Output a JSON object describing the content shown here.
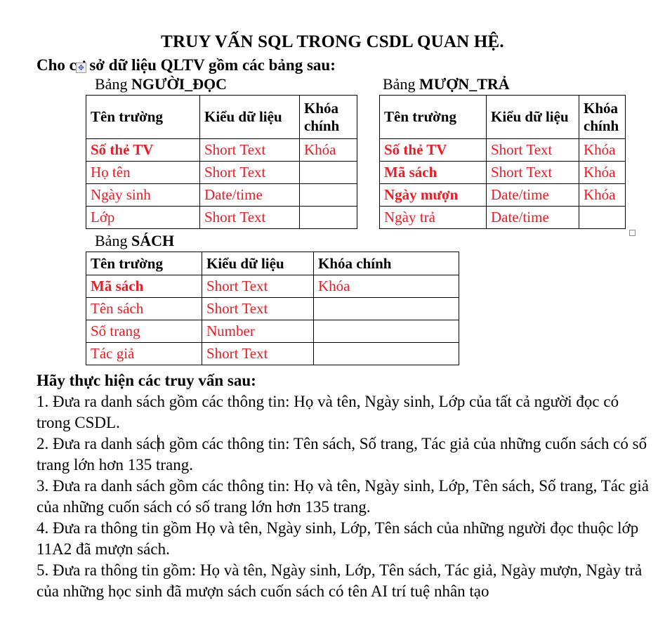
{
  "document": {
    "title": "TRUY VẤN SQL TRONG CSDL QUAN HỆ.",
    "intro": "Cho cơ sở dữ liệu QLTV gồm các bảng sau:",
    "move_handle_glyph": "✥",
    "text_color": "#000000",
    "value_color": "#ee1b24"
  },
  "tables": {
    "nguoi_doc": {
      "caption_prefix": "Bảng ",
      "caption_name": "NGƯỜI_ĐỌC",
      "headers": [
        "Tên trường",
        "Kiểu dữ liệu",
        "Khóa chính"
      ],
      "rows": [
        {
          "field": "Số thẻ TV",
          "type": "Short Text",
          "key": "Khóa",
          "bold": true
        },
        {
          "field": "Họ tên",
          "type": "Short Text",
          "key": "",
          "bold": false
        },
        {
          "field": "Ngày sinh",
          "type": "Date/time",
          "key": "",
          "bold": false
        },
        {
          "field": "Lớp",
          "type": "Short Text",
          "key": "",
          "bold": false
        }
      ]
    },
    "muon_tra": {
      "caption_prefix": "Bảng ",
      "caption_name": "MƯỢN_TRẢ",
      "headers": [
        "Tên trường",
        "Kiểu dữ liệu",
        "Khóa chính"
      ],
      "rows": [
        {
          "field": "Số thẻ TV",
          "type": "Short Text",
          "key": "Khóa",
          "bold": true
        },
        {
          "field": "Mã sách",
          "type": "Short Text",
          "key": "Khóa",
          "bold": true
        },
        {
          "field": "Ngày mượn",
          "type": "Date/time",
          "key": "Khóa",
          "bold": true
        },
        {
          "field": "Ngày trả",
          "type": "Date/time",
          "key": "",
          "bold": false
        }
      ]
    },
    "sach": {
      "caption_prefix": "Bảng ",
      "caption_name": "SÁCH",
      "headers": [
        "Tên trường",
        "Kiểu dữ liệu",
        "Khóa chính"
      ],
      "rows": [
        {
          "field": "Mã sách",
          "type": "Short Text",
          "key": "Khóa",
          "bold": true
        },
        {
          "field": "Tên sách",
          "type": "Short Text",
          "key": "",
          "bold": false
        },
        {
          "field": "Số trang",
          "type": "Number",
          "key": "",
          "bold": false
        },
        {
          "field": "Tác giả",
          "type": "Short Text",
          "key": "",
          "bold": false
        }
      ]
    }
  },
  "questions": {
    "lead": "Hãy thực hiện các truy vấn sau:",
    "items": [
      "1. Đưa ra danh sách gồm các thông tin: Họ và tên, Ngày sinh, Lớp của tất cả người đọc có trong CSDL.",
      "2. Đưa ra danh sách gồm các thông tin: Tên sách, Số trang, Tác giả của những cuốn sách có số trang lớn hơn 135 trang.",
      "3. Đưa ra danh sách gồm các thông tin: Họ và tên, Ngày sinh, Lớp, Tên sách, Số trang, Tác giả của những cuốn sách có số trang lớn hơn 135 trang.",
      "4. Đưa ra thông tin gồm Họ và tên, Ngày sinh, Lớp, Tên sách của những người đọc thuộc lớp 11A2 đã mượn sách.",
      "5. Đưa ra thông tin gồm: Họ và tên, Ngày sinh, Lớp, Tên sách, Tác giả, Ngày mượn, Ngày trả của những học sinh đã mượn sách cuốn sách có tên AI trí tuệ nhân tạo"
    ]
  }
}
